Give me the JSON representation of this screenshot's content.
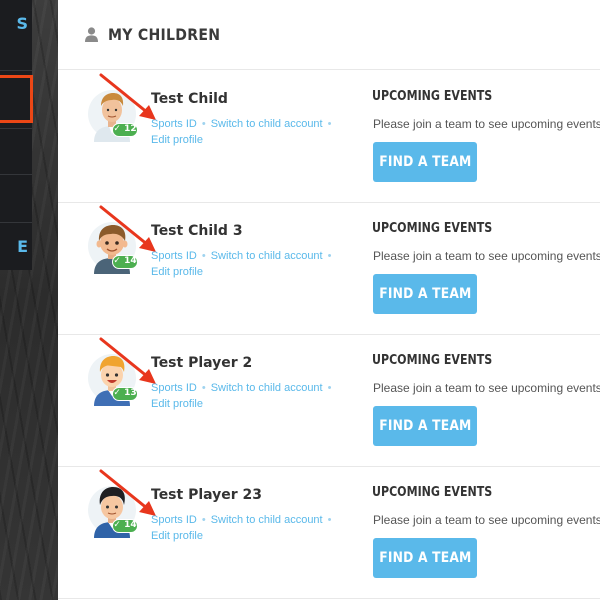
{
  "sidebar": {
    "items": [
      {
        "text": "S"
      },
      {
        "text": ""
      },
      {
        "text": ""
      },
      {
        "text": ""
      },
      {
        "text": "E"
      }
    ],
    "highlight_color": "#ec4716",
    "accent_color": "#5ab9ea"
  },
  "header": {
    "title": "MY CHILDREN",
    "icon": "user-icon"
  },
  "children": [
    {
      "name": "Test Child",
      "age": "12",
      "avatar": "boy-avatar-white-shirt",
      "links": {
        "sports_id": "Sports ID",
        "switch": "Switch to child account",
        "edit": "Edit profile"
      },
      "events_title": "UPCOMING EVENTS",
      "events_message": "Please join a team to see upcoming events.",
      "button_label": "FIND A TEAM"
    },
    {
      "name": "Test Child 3",
      "age": "14",
      "avatar": "boy-avatar-brown-hair",
      "links": {
        "sports_id": "Sports ID",
        "switch": "Switch to child account",
        "edit": "Edit profile"
      },
      "events_title": "UPCOMING EVENTS",
      "events_message": "Please join a team to see upcoming events.",
      "button_label": "FIND A TEAM"
    },
    {
      "name": "Test Player 2",
      "age": "13",
      "avatar": "boy-avatar-blond",
      "links": {
        "sports_id": "Sports ID",
        "switch": "Switch to child account",
        "edit": "Edit profile"
      },
      "events_title": "UPCOMING EVENTS",
      "events_message": "Please join a team to see upcoming events.",
      "button_label": "FIND A TEAM"
    },
    {
      "name": "Test Player 23",
      "age": "14",
      "avatar": "boy-avatar-black-hair",
      "links": {
        "sports_id": "Sports ID",
        "switch": "Switch to child account",
        "edit": "Edit profile"
      },
      "events_title": "UPCOMING EVENTS",
      "events_message": "Please join a team to see upcoming events.",
      "button_label": "FIND A TEAM"
    }
  ],
  "colors": {
    "accent": "#5ab9ea",
    "badge": "#4caf50",
    "annotation_arrow": "#e8361d"
  }
}
